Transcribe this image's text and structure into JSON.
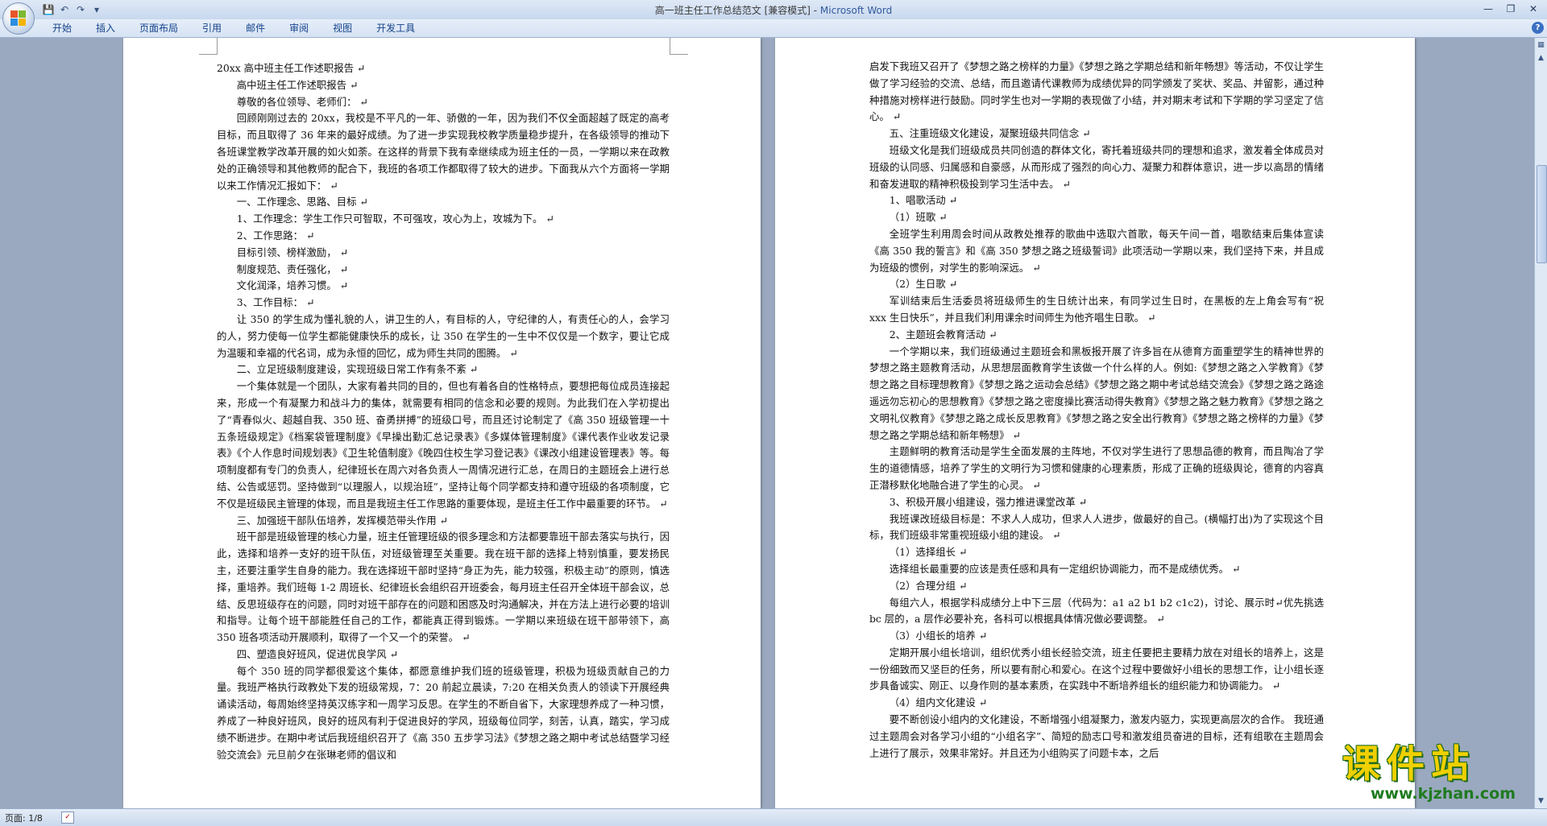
{
  "window": {
    "title": "高一班主任工作总结范文 [兼容模式] - ",
    "app_name": "Microsoft Word"
  },
  "ribbon": {
    "tabs": [
      "开始",
      "插入",
      "页面布局",
      "引用",
      "邮件",
      "审阅",
      "视图",
      "开发工具"
    ]
  },
  "status": {
    "page": "页面: 1/8"
  },
  "watermark": {
    "name": "课件站",
    "url": "www.kjzhan.com"
  },
  "left_page": {
    "paragraphs": [
      {
        "text": "20xx 高中班主任工作述职报告 ↵",
        "noindent": true
      },
      {
        "text": "高中班主任工作述职报告 ↵"
      },
      {
        "text": "尊敬的各位领导、老师们： ↵"
      },
      {
        "text": "回顾刚刚过去的 20xx，我校是不平凡的一年、骄傲的一年，因为我们不仅全面超越了既定的高考目标，而且取得了 36 年来的最好成绩。为了进一步实现我校教学质量稳步提升，在各级领导的推动下各班课堂教学改革开展的如火如荼。在这样的背景下我有幸继续成为班主任的一员，一学期以来在政教处的正确领导和其他教师的配合下，我班的各项工作都取得了较大的进步。下面我从六个方面将一学期以来工作情况汇报如下： ↵"
      },
      {
        "text": "一、工作理念、思路、目标 ↵"
      },
      {
        "text": "1、工作理念：学生工作只可智取，不可强攻，攻心为上，攻城为下。 ↵"
      },
      {
        "text": "2、工作思路： ↵"
      },
      {
        "text": "目标引领、榜样激励， ↵"
      },
      {
        "text": "制度规范、责任强化， ↵"
      },
      {
        "text": "文化润泽，培养习惯。 ↵"
      },
      {
        "text": "3、工作目标： ↵"
      },
      {
        "text": "让 350 的学生成为懂礼貌的人，讲卫生的人，有目标的人，守纪律的人，有责任心的人，会学习的人，努力使每一位学生都能健康快乐的成长，让 350 在学生的一生中不仅仅是一个数字，要让它成为温暖和幸福的代名词，成为永恒的回忆，成为师生共同的图腾。 ↵"
      },
      {
        "text": "二、立足班级制度建设，实现班级日常工作有条不紊 ↵"
      },
      {
        "text": "一个集体就是一个团队，大家有着共同的目的，但也有着各自的性格特点，要想把每位成员连接起来，形成一个有凝聚力和战斗力的集体，就需要有相同的信念和必要的规则。为此我们在入学初提出了“青春似火、超越自我、350 班、奋勇拼搏”的班级口号，而且还讨论制定了《高 350 班级管理一十五条班级规定》《档案袋管理制度》《早操出勤汇总记录表》《多媒体管理制度》《课代表作业收发记录表》《个人作息时间规划表》《卫生轮值制度》《晚四住校生学习登记表》《课改小组建设管理表》等。每项制度都有专门的负责人，纪律班长在周六对各负责人一周情况进行汇总，在周日的主题班会上进行总结、公告或惩罚。坚持做到“以理服人，以规治班”，坚持让每个同学都支持和遵守班级的各项制度，它不仅是班级民主管理的体现，而且是我班主任工作思路的重要体现，是班主任工作中最重要的环节。 ↵"
      },
      {
        "text": "三、加强班干部队伍培养，发挥模范带头作用 ↵"
      },
      {
        "text": "班干部是班级管理的核心力量，班主任管理班级的很多理念和方法都要靠班干部去落实与执行，因此，选择和培养一支好的班干队伍，对班级管理至关重要。我在班干部的选择上特别慎重，要发扬民主，还要注重学生自身的能力。我在选择班干部时坚持“身正为先，能力较强，积极主动”的原则，慎选择，重培养。我们班每 1-2 周班长、纪律班长会组织召开班委会，每月班主任召开全体班干部会议，总结、反思班级存在的问题，同时对班干部存在的问题和困惑及时沟通解决，并在方法上进行必要的培训和指导。让每个班干部能胜任自己的工作，都能真正得到锻炼。一学期以来班级在班干部带领下，高 350 班各项活动开展顺利，取得了一个又一个的荣誉。 ↵"
      },
      {
        "text": "四、塑造良好班风，促进优良学风 ↵"
      },
      {
        "text": "每个 350 班的同学都很爱这个集体，都愿意维护我们班的班级管理，积极为班级贡献自己的力量。我班严格执行政教处下发的班级常规，7：20 前起立晨读，7:20 在相关负责人的领读下开展经典诵读活动，每周始终坚持英汉练字和一周学习反思。在学生的不断自省下，大家理想养成了一种习惯，养成了一种良好班风，良好的班风有利于促进良好的学风，班级每位同学，刻苦，认真，踏实，学习成绩不断进步。在期中考试后我班组织召开了《高 350 五步学习法》《梦想之路之期中考试总结暨学习经验交流会》元旦前夕在张琳老师的倡议和"
      }
    ]
  },
  "right_page": {
    "paragraphs": [
      {
        "text": "启发下我班又召开了《梦想之路之榜样的力量》《梦想之路之学期总结和新年畅想》等活动，不仅让学生做了学习经验的交流、总结，而且邀请代课教师为成绩优异的同学颁发了奖状、奖品、并留影，通过种种措施对榜样进行鼓励。同时学生也对一学期的表现做了小结，并对期末考试和下学期的学习坚定了信心。 ↵",
        "noindent": true
      },
      {
        "text": "五、注重班级文化建设，凝聚班级共同信念 ↵"
      },
      {
        "text": "班级文化是我们班级成员共同创造的群体文化，寄托着班级共同的理想和追求，激发着全体成员对班级的认同感、归属感和自豪感，从而形成了强烈的向心力、凝聚力和群体意识，进一步以高昂的情绪和奋发进取的精神积极投到学习生活中去。 ↵"
      },
      {
        "text": "1、唱歌活动 ↵"
      },
      {
        "text": "（1）班歌 ↵"
      },
      {
        "text": "全班学生利用周会时间从政教处推荐的歌曲中选取六首歌，每天午间一首，唱歌结束后集体宣读《高 350 我的誓言》和《高 350 梦想之路之班级誓词》此项活动一学期以来，我们坚持下来，并且成为班级的惯例，对学生的影响深远。 ↵"
      },
      {
        "text": "（2）生日歌 ↵"
      },
      {
        "text": "军训结束后生活委员将班级师生的生日统计出来，有同学过生日时，在黑板的左上角会写有“祝 xxx 生日快乐”，并且我们利用课余时间师生为他齐唱生日歌。 ↵"
      },
      {
        "text": "2、主题班会教育活动 ↵"
      },
      {
        "text": "一个学期以来，我们班级通过主题班会和黑板报开展了许多旨在从德育方面重塑学生的精神世界的梦想之路主题教育活动，从思想层面教育学生该做一个什么样的人。例如:《梦想之路之入学教育》《梦想之路之目标理想教育》《梦想之路之运动会总结》《梦想之路之期中考试总结交流会》《梦想之路之路途遥远勿忘初心的思想教育》《梦想之路之密度操比赛活动得失教育》《梦想之路之魅力教育》《梦想之路之文明礼仪教育》《梦想之路之成长反思教育》《梦想之路之安全出行教育》《梦想之路之榜样的力量》《梦想之路之学期总结和新年畅想》 ↵"
      },
      {
        "text": "主题鲜明的教育活动是学生全面发展的主阵地，不仅对学生进行了思想品德的教育，而且陶冶了学生的道德情感，培养了学生的文明行为习惯和健康的心理素质，形成了正确的班级舆论，德育的内容真正潜移默化地融合进了学生的心灵。 ↵"
      },
      {
        "text": "3、积极开展小组建设，强力推进课堂改革 ↵"
      },
      {
        "text": "我班课改班级目标是：不求人人成功，但求人人进步，做最好的自己。(横幅打出)为了实现这个目标，我们班级非常重视班级小组的建设。 ↵"
      },
      {
        "text": "（1）选择组长 ↵"
      },
      {
        "text": "选择组长最重要的应该是责任感和具有一定组织协调能力，而不是成绩优秀。 ↵"
      },
      {
        "text": "（2）合理分组 ↵"
      },
      {
        "text": "每组六人，根据学科成绩分上中下三层（代码为：a1 a2 b1 b2 c1c2)，讨论、展示时↵优先挑选 bc 层的，a 层作必要补充，各科可以根据具体情况做必要调整。 ↵"
      },
      {
        "text": "（3）小组长的培养 ↵"
      },
      {
        "text": "定期开展小组长培训，组织优秀小组长经验交流，班主任要把主要精力放在对组长的培养上，这是一份细致而又坚巨的任务，所以要有耐心和爱心。在这个过程中要做好小组长的思想工作，让小组长逐步具备诚实、刚正、以身作则的基本素质，在实践中不断培养组长的组织能力和协调能力。 ↵"
      },
      {
        "text": "（4）组内文化建设 ↵"
      },
      {
        "text": "要不断创设小组内的文化建设，不断增强小组凝聚力，激发内驱力，实现更高层次的合作。 我班通过主题周会对各学习小组的“小组名字”、简短的励志口号和激发组员奋进的目标，还有组歌在主题周会上进行了展示，效果非常好。并且还为小组购买了问题卡本，之后"
      }
    ]
  }
}
